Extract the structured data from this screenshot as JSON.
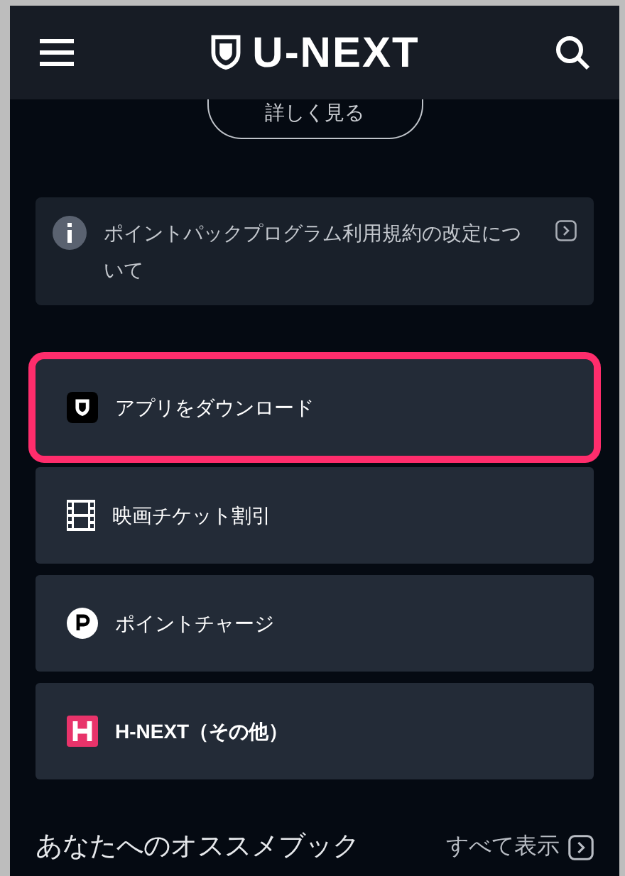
{
  "header": {
    "logo": "U-NEXT"
  },
  "details_button": {
    "label": "詳しく見る"
  },
  "notice": {
    "text": "ポイントパックプログラム利用規約の改定について"
  },
  "menu": [
    {
      "kind": "app",
      "label": "アプリをダウンロード",
      "highlighted": true
    },
    {
      "kind": "film",
      "label": "映画チケット割引",
      "highlighted": false
    },
    {
      "kind": "point",
      "label": "ポイントチャージ",
      "highlighted": false
    },
    {
      "kind": "hnext",
      "label": "H-NEXT（その他）",
      "highlighted": false
    }
  ],
  "section": {
    "title": "あなたへのオススメブック",
    "link": "すべて表示"
  }
}
